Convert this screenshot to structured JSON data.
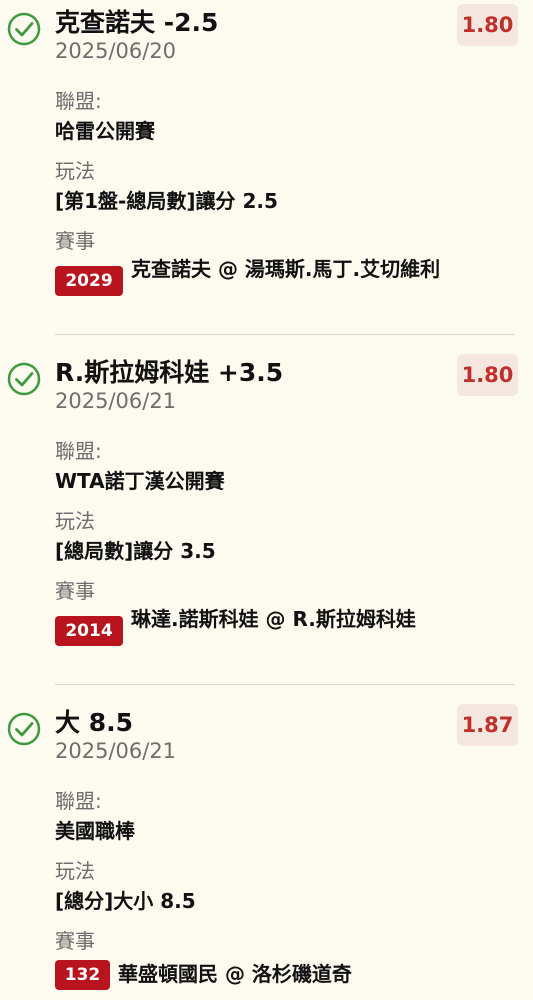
{
  "colors": {
    "check": "#3f9a3f",
    "odds_text": "#c0302a",
    "odds_bg": "#f5e6df",
    "badge_bg": "#b8141d",
    "background": "#fdfaf0"
  },
  "labels": {
    "league": "聯盟:",
    "play": "玩法",
    "event": "賽事"
  },
  "bets": [
    {
      "status_icon": "check-circle-icon",
      "title": "克查諾夫 -2.5",
      "date": "2025/06/20",
      "odds": "1.80",
      "league": "哈雷公開賽",
      "play": "[第1盤-總局數]讓分 2.5",
      "event_id": "2029",
      "event_name": "克查諾夫 @ 湯瑪斯.馬丁.艾切維利"
    },
    {
      "status_icon": "check-circle-icon",
      "title": "R.斯拉姆科娃 +3.5",
      "date": "2025/06/21",
      "odds": "1.80",
      "league": "WTA諾丁漢公開賽",
      "play": "[總局數]讓分 3.5",
      "event_id": "2014",
      "event_name": "琳達.諾斯科娃 @ R.斯拉姆科娃"
    },
    {
      "status_icon": "check-circle-icon",
      "title": "大 8.5",
      "date": "2025/06/21",
      "odds": "1.87",
      "league": "美國職棒",
      "play": "[總分]大小 8.5",
      "event_id": "132",
      "event_name": "華盛頓國民 @ 洛杉磯道奇"
    }
  ]
}
